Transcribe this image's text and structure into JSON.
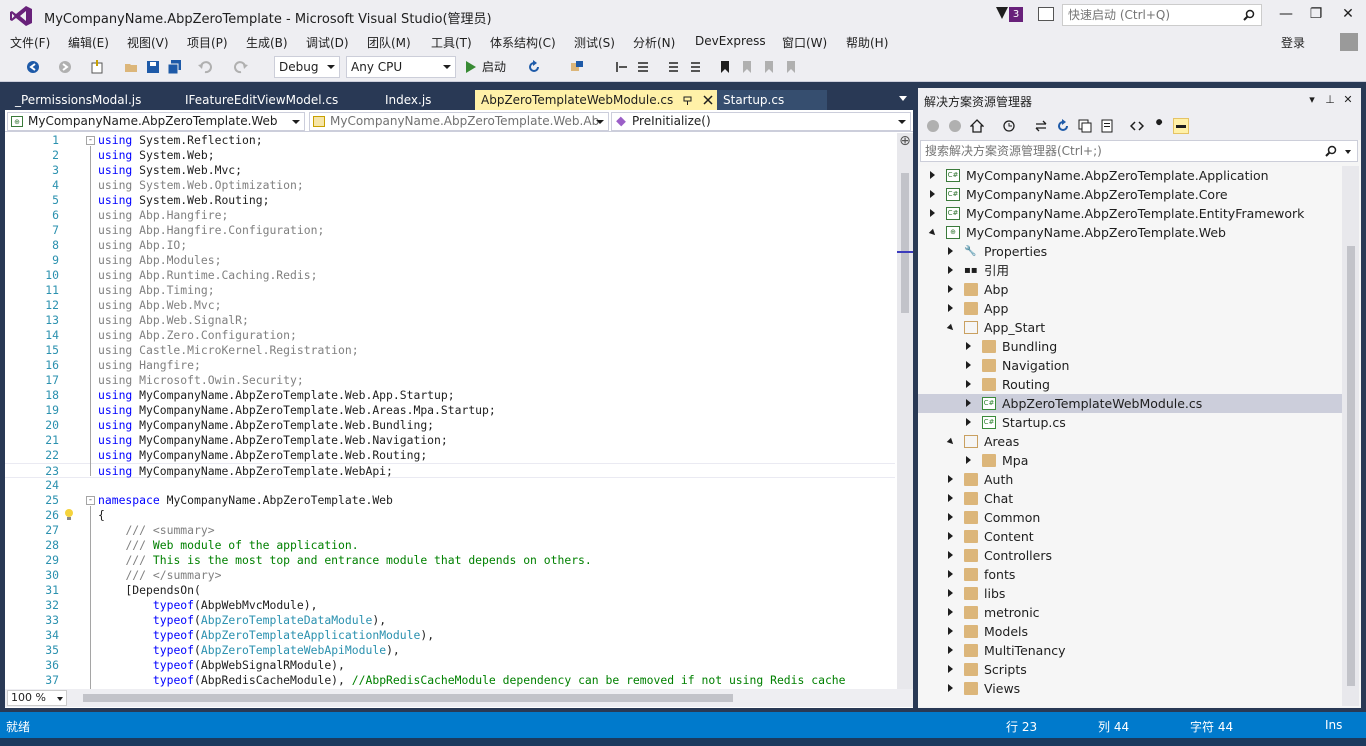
{
  "window": {
    "title": "MyCompanyName.AbpZeroTemplate - Microsoft Visual Studio(管理员)",
    "notification_count": "3",
    "quick_launch_placeholder": "快速启动 (Ctrl+Q)",
    "login_label": "登录"
  },
  "menu": {
    "items": [
      "文件(F)",
      "编辑(E)",
      "视图(V)",
      "项目(P)",
      "生成(B)",
      "调试(D)",
      "团队(M)",
      "工具(T)",
      "体系结构(C)",
      "测试(S)",
      "分析(N)",
      "DevExpress",
      "窗口(W)",
      "帮助(H)"
    ]
  },
  "toolbar": {
    "config": "Debug",
    "platform": "Any CPU",
    "start_label": "启动"
  },
  "tabs": [
    {
      "label": "_PermissionsModal.js",
      "active": false
    },
    {
      "label": "IFeatureEditViewModel.cs",
      "active": false
    },
    {
      "label": "Index.js",
      "active": false
    },
    {
      "label": "AbpZeroTemplateWebModule.cs",
      "active": true
    },
    {
      "label": "Startup.cs",
      "active": false
    }
  ],
  "navbar": {
    "project": "MyCompanyName.AbpZeroTemplate.Web",
    "type": "MyCompanyName.AbpZeroTemplate.Web.Ab",
    "member": "PreInitialize()"
  },
  "code": {
    "lines": [
      [
        [
          "kw",
          "using"
        ],
        [
          "n",
          " System.Reflection;"
        ]
      ],
      [
        [
          "kw",
          "using"
        ],
        [
          "n",
          " System.Web;"
        ]
      ],
      [
        [
          "kw",
          "using"
        ],
        [
          "n",
          " System.Web.Mvc;"
        ]
      ],
      [
        [
          "gray",
          "using System.Web.Optimization;"
        ]
      ],
      [
        [
          "kw",
          "using"
        ],
        [
          "n",
          " System.Web.Routing;"
        ]
      ],
      [
        [
          "gray",
          "using Abp.Hangfire;"
        ]
      ],
      [
        [
          "gray",
          "using Abp.Hangfire.Configuration;"
        ]
      ],
      [
        [
          "gray",
          "using Abp.IO;"
        ]
      ],
      [
        [
          "gray",
          "using Abp.Modules;"
        ]
      ],
      [
        [
          "gray",
          "using Abp.Runtime.Caching.Redis;"
        ]
      ],
      [
        [
          "gray",
          "using Abp.Timing;"
        ]
      ],
      [
        [
          "gray",
          "using Abp.Web.Mvc;"
        ]
      ],
      [
        [
          "gray",
          "using Abp.Web.SignalR;"
        ]
      ],
      [
        [
          "gray",
          "using Abp.Zero.Configuration;"
        ]
      ],
      [
        [
          "gray",
          "using Castle.MicroKernel.Registration;"
        ]
      ],
      [
        [
          "gray",
          "using Hangfire;"
        ]
      ],
      [
        [
          "gray",
          "using Microsoft.Owin.Security;"
        ]
      ],
      [
        [
          "kw",
          "using"
        ],
        [
          "n",
          " MyCompanyName.AbpZeroTemplate.Web.App.Startup;"
        ]
      ],
      [
        [
          "kw",
          "using"
        ],
        [
          "n",
          " MyCompanyName.AbpZeroTemplate.Web.Areas.Mpa.Startup;"
        ]
      ],
      [
        [
          "kw",
          "using"
        ],
        [
          "n",
          " MyCompanyName.AbpZeroTemplate.Web.Bundling;"
        ]
      ],
      [
        [
          "kw",
          "using"
        ],
        [
          "n",
          " MyCompanyName.AbpZeroTemplate.Web.Navigation;"
        ]
      ],
      [
        [
          "kw",
          "using"
        ],
        [
          "n",
          " MyCompanyName.AbpZeroTemplate.Web.Routing;"
        ]
      ],
      [
        [
          "kw",
          "using"
        ],
        [
          "n",
          " MyCompanyName.AbpZeroTemplate.WebApi;"
        ]
      ],
      [
        [
          "n",
          ""
        ]
      ],
      [
        [
          "kw",
          "namespace"
        ],
        [
          "n",
          " MyCompanyName.AbpZeroTemplate.Web"
        ]
      ],
      [
        [
          "n",
          "{"
        ]
      ],
      [
        [
          "n",
          "    "
        ],
        [
          "xd",
          "/// <summary>"
        ]
      ],
      [
        [
          "n",
          "    "
        ],
        [
          "xd",
          "///"
        ],
        [
          "cm",
          " Web module of the application."
        ]
      ],
      [
        [
          "n",
          "    "
        ],
        [
          "xd",
          "///"
        ],
        [
          "cm",
          " This is the most top and entrance module that depends on others."
        ]
      ],
      [
        [
          "n",
          "    "
        ],
        [
          "xd",
          "/// </summary>"
        ]
      ],
      [
        [
          "n",
          "    [DependsOn("
        ]
      ],
      [
        [
          "n",
          "        "
        ],
        [
          "kw",
          "typeof"
        ],
        [
          "n",
          "(AbpWebMvcModule),"
        ]
      ],
      [
        [
          "n",
          "        "
        ],
        [
          "kw",
          "typeof"
        ],
        [
          "n",
          "("
        ],
        [
          "ty",
          "AbpZeroTemplateDataModule"
        ],
        [
          "n",
          "),"
        ]
      ],
      [
        [
          "n",
          "        "
        ],
        [
          "kw",
          "typeof"
        ],
        [
          "n",
          "("
        ],
        [
          "ty",
          "AbpZeroTemplateApplicationModule"
        ],
        [
          "n",
          "),"
        ]
      ],
      [
        [
          "n",
          "        "
        ],
        [
          "kw",
          "typeof"
        ],
        [
          "n",
          "("
        ],
        [
          "ty",
          "AbpZeroTemplateWebApiModule"
        ],
        [
          "n",
          "),"
        ]
      ],
      [
        [
          "n",
          "        "
        ],
        [
          "kw",
          "typeof"
        ],
        [
          "n",
          "(AbpWebSignalRModule),"
        ]
      ],
      [
        [
          "n",
          "        "
        ],
        [
          "kw",
          "typeof"
        ],
        [
          "n",
          "(AbpRedisCacheModule), "
        ],
        [
          "cm",
          "//AbpRedisCacheModule dependency can be removed if not using Redis cache"
        ]
      ]
    ]
  },
  "zoom": "100 %",
  "solution_explorer": {
    "title": "解决方案资源管理器",
    "search_placeholder": "搜索解决方案资源管理器(Ctrl+;)",
    "items": [
      {
        "label": "MyCompanyName.AbpZeroTemplate.Application",
        "level": 0,
        "state": "collapsed",
        "icon": "project-icon"
      },
      {
        "label": "MyCompanyName.AbpZeroTemplate.Core",
        "level": 0,
        "state": "collapsed",
        "icon": "project-icon"
      },
      {
        "label": "MyCompanyName.AbpZeroTemplate.EntityFramework",
        "level": 0,
        "state": "collapsed",
        "icon": "project-icon"
      },
      {
        "label": "MyCompanyName.AbpZeroTemplate.Web",
        "level": 0,
        "state": "expanded",
        "icon": "web-project-icon"
      },
      {
        "label": "Properties",
        "level": 1,
        "state": "collapsed",
        "icon": "wrench-icon"
      },
      {
        "label": "引用",
        "level": 1,
        "state": "collapsed",
        "icon": "references-icon"
      },
      {
        "label": "Abp",
        "level": 1,
        "state": "collapsed",
        "icon": "folder-icon"
      },
      {
        "label": "App",
        "level": 1,
        "state": "collapsed",
        "icon": "folder-icon"
      },
      {
        "label": "App_Start",
        "level": 1,
        "state": "expanded",
        "icon": "folder-open-icon"
      },
      {
        "label": "Bundling",
        "level": 2,
        "state": "collapsed",
        "icon": "folder-icon"
      },
      {
        "label": "Navigation",
        "level": 2,
        "state": "collapsed",
        "icon": "folder-icon"
      },
      {
        "label": "Routing",
        "level": 2,
        "state": "collapsed",
        "icon": "folder-icon"
      },
      {
        "label": "AbpZeroTemplateWebModule.cs",
        "level": 2,
        "state": "collapsed",
        "icon": "csharp-file-icon",
        "selected": true
      },
      {
        "label": "Startup.cs",
        "level": 2,
        "state": "collapsed",
        "icon": "csharp-file-icon"
      },
      {
        "label": "Areas",
        "level": 1,
        "state": "expanded",
        "icon": "folder-open-icon"
      },
      {
        "label": "Mpa",
        "level": 2,
        "state": "collapsed",
        "icon": "folder-icon"
      },
      {
        "label": "Auth",
        "level": 1,
        "state": "collapsed",
        "icon": "folder-icon"
      },
      {
        "label": "Chat",
        "level": 1,
        "state": "collapsed",
        "icon": "folder-icon"
      },
      {
        "label": "Common",
        "level": 1,
        "state": "collapsed",
        "icon": "folder-icon"
      },
      {
        "label": "Content",
        "level": 1,
        "state": "collapsed",
        "icon": "folder-icon"
      },
      {
        "label": "Controllers",
        "level": 1,
        "state": "collapsed",
        "icon": "folder-icon"
      },
      {
        "label": "fonts",
        "level": 1,
        "state": "collapsed",
        "icon": "folder-icon"
      },
      {
        "label": "libs",
        "level": 1,
        "state": "collapsed",
        "icon": "folder-icon"
      },
      {
        "label": "metronic",
        "level": 1,
        "state": "collapsed",
        "icon": "folder-icon"
      },
      {
        "label": "Models",
        "level": 1,
        "state": "collapsed",
        "icon": "folder-icon"
      },
      {
        "label": "MultiTenancy",
        "level": 1,
        "state": "collapsed",
        "icon": "folder-icon"
      },
      {
        "label": "Scripts",
        "level": 1,
        "state": "collapsed",
        "icon": "folder-icon"
      },
      {
        "label": "Views",
        "level": 1,
        "state": "collapsed",
        "icon": "folder-icon"
      }
    ]
  },
  "status": {
    "ready": "就绪",
    "line": "行 23",
    "col": "列 44",
    "char": "字符 44",
    "mode": "Ins"
  },
  "colors": {
    "accent": "#007acc",
    "frame": "#293955",
    "active_tab": "#fff1a8",
    "vs_purple": "#68217a"
  }
}
